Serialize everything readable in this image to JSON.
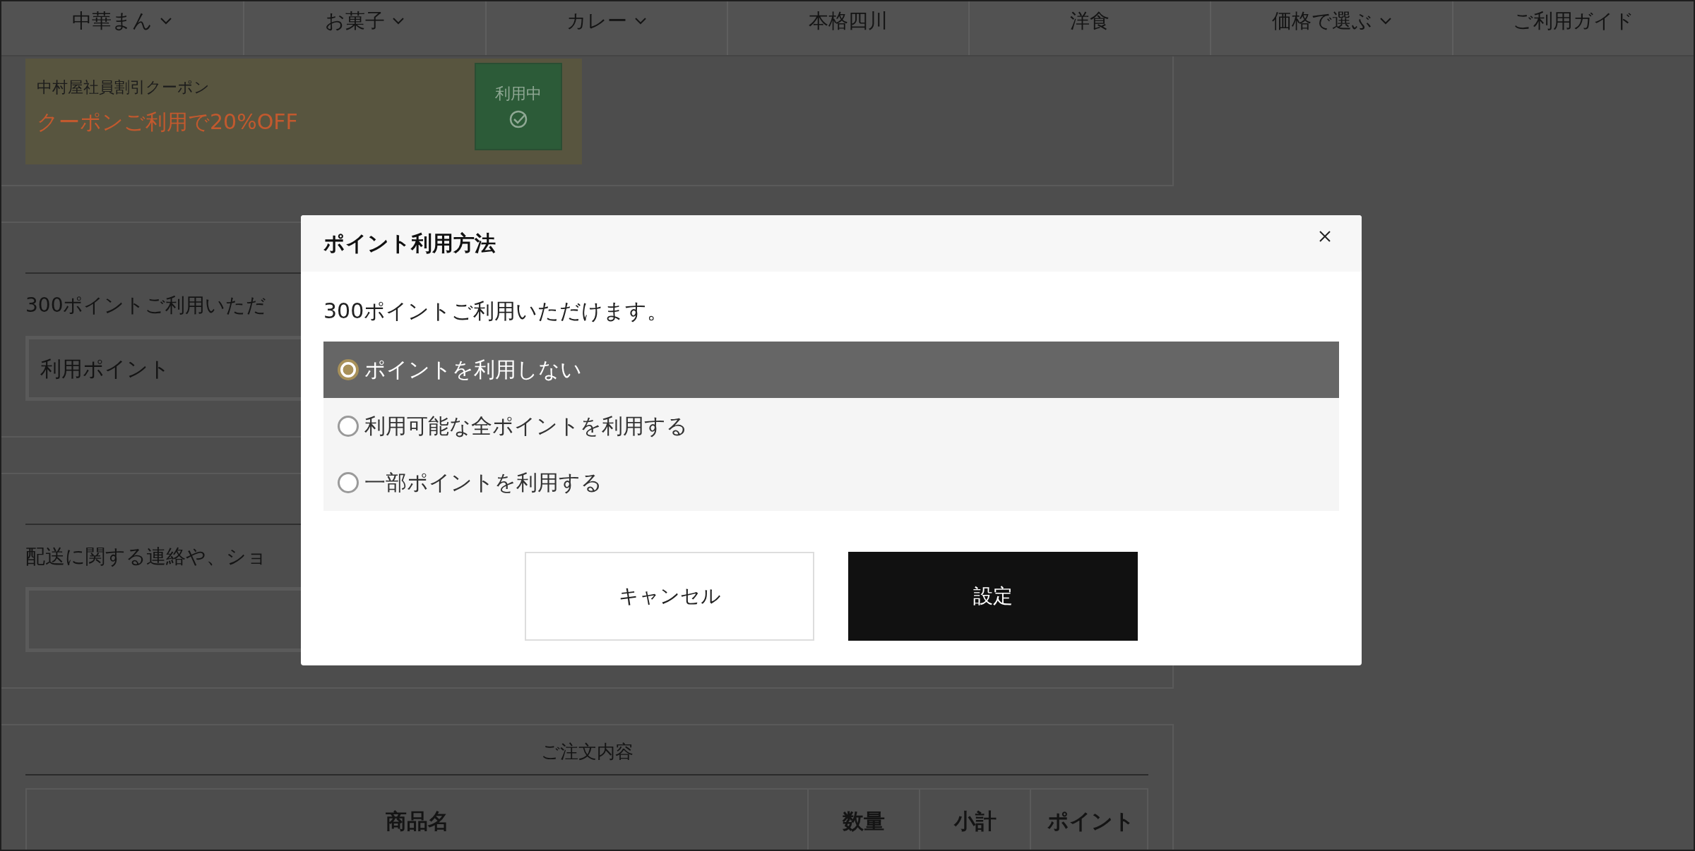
{
  "nav": {
    "items": [
      {
        "label": "中華まん",
        "dropdown": true
      },
      {
        "label": "お菓子",
        "dropdown": true
      },
      {
        "label": "カレー",
        "dropdown": true
      },
      {
        "label": "本格四川",
        "dropdown": false
      },
      {
        "label": "洋食",
        "dropdown": false
      },
      {
        "label": "価格で選ぶ",
        "dropdown": true
      },
      {
        "label": "ご利用ガイド",
        "dropdown": false
      }
    ]
  },
  "coupon": {
    "name": "中村屋社員割引クーポン",
    "offer": "クーポンご利用で20%OFF",
    "button": {
      "label": "利用中",
      "applied": true
    }
  },
  "points_section": {
    "text": "300ポイントご利用いただ",
    "field": {
      "placeholder": "利用ポイント"
    }
  },
  "message_section": {
    "text": "配送に関する連絡や、ショ"
  },
  "order": {
    "title": "ご注文内容",
    "columns": [
      "商品名",
      "数量",
      "小計",
      "ポイント"
    ]
  },
  "dialog": {
    "title": "ポイント利用方法",
    "message": "300ポイントご利用いただけます。",
    "options": [
      {
        "label": "ポイントを利用しない",
        "selected": true
      },
      {
        "label": "利用可能な全ポイントを利用する",
        "selected": false
      },
      {
        "label": "一部ポイントを利用する",
        "selected": false
      }
    ],
    "buttons": [
      {
        "label": "キャンセル",
        "kind": "secondary"
      },
      {
        "label": "設定",
        "kind": "primary"
      }
    ]
  }
}
